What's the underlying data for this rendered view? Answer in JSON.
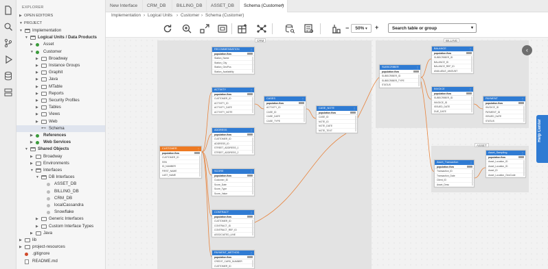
{
  "activity_bar": {
    "icons": [
      "files-icon",
      "search-icon",
      "source-control-icon",
      "run-debug-icon",
      "database-icon",
      "server-icon"
    ]
  },
  "explorer": {
    "title": "EXPLORER",
    "open_editors": "OPEN EDITORS",
    "project": "PROJECT",
    "tree": [
      {
        "label": "Implementation",
        "depth": 1,
        "kind": "folder",
        "open": true
      },
      {
        "label": "Logical Units / Data Products",
        "depth": 2,
        "kind": "folder",
        "open": true,
        "bold": true
      },
      {
        "label": "Asset",
        "depth": 3,
        "kind": "dot",
        "color": "#3a9a3a"
      },
      {
        "label": "Customer",
        "depth": 3,
        "kind": "dot",
        "color": "#3a9a3a",
        "open": true
      },
      {
        "label": "Broadway",
        "depth": 4,
        "kind": "folder"
      },
      {
        "label": "Instance Groups",
        "depth": 4,
        "kind": "folder"
      },
      {
        "label": "Graphit",
        "depth": 4,
        "kind": "folder"
      },
      {
        "label": "Java",
        "depth": 4,
        "kind": "folder"
      },
      {
        "label": "MTable",
        "depth": 4,
        "kind": "folder"
      },
      {
        "label": "Reports",
        "depth": 4,
        "kind": "folder"
      },
      {
        "label": "Security Profiles",
        "depth": 4,
        "kind": "folder"
      },
      {
        "label": "Tables",
        "depth": 4,
        "kind": "folder"
      },
      {
        "label": "Views",
        "depth": 4,
        "kind": "folder"
      },
      {
        "label": "Web",
        "depth": 4,
        "kind": "folder"
      },
      {
        "label": "Schema",
        "depth": 4,
        "kind": "schema",
        "selected": true
      },
      {
        "label": "References",
        "depth": 3,
        "kind": "dot",
        "color": "#3a9a3a",
        "bold": true
      },
      {
        "label": "Web Services",
        "depth": 3,
        "kind": "dot",
        "color": "#3a9a3a",
        "bold": true
      },
      {
        "label": "Shared Objects",
        "depth": 2,
        "kind": "folder",
        "open": true,
        "bold": true
      },
      {
        "label": "Broadway",
        "depth": 3,
        "kind": "folder"
      },
      {
        "label": "Environments",
        "depth": 3,
        "kind": "folder"
      },
      {
        "label": "Interfaces",
        "depth": 3,
        "kind": "folder",
        "open": true
      },
      {
        "label": "DB Interfaces",
        "depth": 4,
        "kind": "folder",
        "open": true
      },
      {
        "label": "ASSET_DB",
        "depth": 5,
        "kind": "db"
      },
      {
        "label": "BILLING_DB",
        "depth": 5,
        "kind": "db"
      },
      {
        "label": "CRM_DB",
        "depth": 5,
        "kind": "db"
      },
      {
        "label": "localCassandra",
        "depth": 5,
        "kind": "db"
      },
      {
        "label": "Snowflake",
        "depth": 5,
        "kind": "db"
      },
      {
        "label": "Generic Interfaces",
        "depth": 4,
        "kind": "folder"
      },
      {
        "label": "Custom Interface Types",
        "depth": 4,
        "kind": "folder"
      },
      {
        "label": "Java",
        "depth": 3,
        "kind": "folder"
      },
      {
        "label": "lib",
        "depth": 1,
        "kind": "folder"
      },
      {
        "label": "project-resources",
        "depth": 1,
        "kind": "folder"
      },
      {
        "label": ".gitignore",
        "depth": 1,
        "kind": "gitfile"
      },
      {
        "label": "README.md",
        "depth": 1,
        "kind": "file"
      }
    ]
  },
  "tabs": [
    {
      "label": "New Interface",
      "active": false
    },
    {
      "label": "CRM_DB",
      "active": false
    },
    {
      "label": "BILLING_DB",
      "active": false
    },
    {
      "label": "ASSET_DB",
      "active": false
    },
    {
      "label": "Schema (Customer)",
      "active": true,
      "close": "×"
    }
  ],
  "breadcrumb": [
    "Implementation",
    "Logical Units",
    "Customer",
    "Schema (Customer)"
  ],
  "breadcrumb_sep": "›",
  "toolbar": {
    "buttons": [
      "refresh-icon",
      "zoom-in-icon",
      "fit-screen-icon",
      "group-icon",
      "add-table-icon",
      "graph-icon",
      "database-query-icon",
      "inspect-icon",
      "align-icon"
    ],
    "zoom_minus": "−",
    "zoom_value": "50%",
    "zoom_plus": "+",
    "search_label": "Search table or group",
    "search_chevron": "▾"
  },
  "canvas": {
    "groups": [
      {
        "label": "CRM"
      },
      {
        "label": "BILLING"
      },
      {
        "label": "ASSET"
      }
    ],
    "population_label": "population.flow",
    "tables": [
      {
        "name": "RECOMMENDATION",
        "fields": [
          "Station_Name",
          "Station_City",
          "Station_GeoPos",
          "Station_Availability"
        ]
      },
      {
        "name": "ACTIVITY",
        "fields": [
          "CUSTOMER_ID",
          "ACTIVITY_ID",
          "ACTIVITY_DATE",
          "ACTIVITY_NOTE"
        ]
      },
      {
        "name": "CASES",
        "fields": [
          "ACTIVITY_ID",
          "CASE_ID",
          "CASE_DATE",
          "CASE_TYPE"
        ]
      },
      {
        "name": "CASE_NOTE",
        "fields": [
          "CASE_ID",
          "NOTE_ID",
          "NOTE_DATE",
          "NOTE_TEXT"
        ]
      },
      {
        "name": "CUSTOMER",
        "fields": [
          "CUSTOMER_ID",
          "SSN",
          "ID_NUMBER",
          "FIRST_NAME",
          "LAST_NAME"
        ],
        "orange": true
      },
      {
        "name": "ADDRESS",
        "fields": [
          "CUSTOMER_ID",
          "ADDRESS_ID",
          "STREET_ADDRESS_1",
          "STREET_ADDRESS_2"
        ]
      },
      {
        "name": "SCORE",
        "fields": [
          "Customer_ID",
          "Score_Date",
          "Score_Type",
          "Score_Value"
        ]
      },
      {
        "name": "CONTRACT",
        "fields": [
          "CUSTOMER_ID",
          "CONTRACT_ID",
          "CONTRACT_REF_ID",
          "ASSOCIATED_LINE"
        ]
      },
      {
        "name": "PAYMENT_METHOD",
        "fields": [
          "CREDIT_CARD_NUMBER",
          "CUSTOMER_ID"
        ]
      },
      {
        "name": "SUBSCRIBER",
        "fields": [
          "SUBSCRIBER_ID",
          "SUBSCRIBER_TYPE",
          "STATUS"
        ]
      },
      {
        "name": "BALANCE",
        "fields": [
          "SUBSCRIBER_ID",
          "BALANCE_ID",
          "BALANCE_REF_ID",
          "AVAILABLE_AMOUNT"
        ]
      },
      {
        "name": "INVOICE",
        "fields": [
          "SUBSCRIBER_ID",
          "INVOICE_ID",
          "ISSUED_DATE",
          "DUE_DATE"
        ]
      },
      {
        "name": "PAYMENT",
        "fields": [
          "INVOICE_ID",
          "PAYMENT_ID",
          "ISSUED_DATE",
          "STATUS"
        ]
      },
      {
        "name": "Asset_Transaction",
        "fields": [
          "Transaction_ID",
          "Transaction_Date",
          "Client_ID",
          "Asset_Desc"
        ]
      },
      {
        "name": "Asset_Sampling",
        "fields": [
          "Asset_Location_ID",
          "Asset_Location_ID",
          "Asset_ID",
          "Asset_Location_GeoCode"
        ]
      }
    ]
  },
  "link_color": "#e8823a",
  "collapse_label": "‹",
  "help_center": "Help Center"
}
